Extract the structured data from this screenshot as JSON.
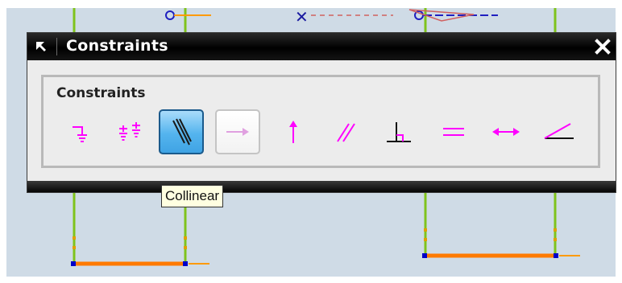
{
  "window": {
    "title": "Constraints",
    "pin_icon": "pin-arrow-icon",
    "close_icon": "close-x-icon"
  },
  "group": {
    "label": "Constraints",
    "buttons": [
      {
        "id": "fixed",
        "icon": "fixed-constraint-icon",
        "state": "normal"
      },
      {
        "id": "fully-fixed",
        "icon": "fully-fixed-constraint-icon",
        "state": "normal"
      },
      {
        "id": "collinear",
        "icon": "collinear-icon",
        "state": "active"
      },
      {
        "id": "horizontal",
        "icon": "horizontal-icon",
        "state": "disabled"
      },
      {
        "id": "vertical",
        "icon": "vertical-icon",
        "state": "normal"
      },
      {
        "id": "parallel",
        "icon": "parallel-icon",
        "state": "normal"
      },
      {
        "id": "perpendicular",
        "icon": "perpendicular-icon",
        "state": "normal"
      },
      {
        "id": "equal-length",
        "icon": "equal-length-icon",
        "state": "normal"
      },
      {
        "id": "constant-length",
        "icon": "constant-length-icon",
        "state": "normal"
      },
      {
        "id": "constant-angle",
        "icon": "constant-angle-icon",
        "state": "normal"
      }
    ]
  },
  "tooltip": {
    "text": "Collinear"
  },
  "colors": {
    "icon_magenta": "#ff00ff",
    "sketch_green": "#7fc31c",
    "sketch_orange": "#ff7a00",
    "sketch_blue": "#0000c8",
    "background": "#cfdbe6"
  }
}
